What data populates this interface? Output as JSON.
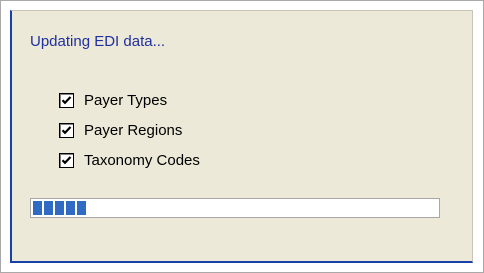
{
  "dialog": {
    "status_text": "Updating EDI data..."
  },
  "checklist": [
    {
      "label": "Payer Types",
      "checked": true
    },
    {
      "label": "Payer Regions",
      "checked": true
    },
    {
      "label": "Taxonomy Codes",
      "checked": true
    }
  ],
  "progress": {
    "percent": 14,
    "fill_color": "#316ac5"
  },
  "colors": {
    "status_text": "#1f2f9e",
    "panel_border": "#1a3fa6",
    "panel_background": "#ece9d8"
  }
}
